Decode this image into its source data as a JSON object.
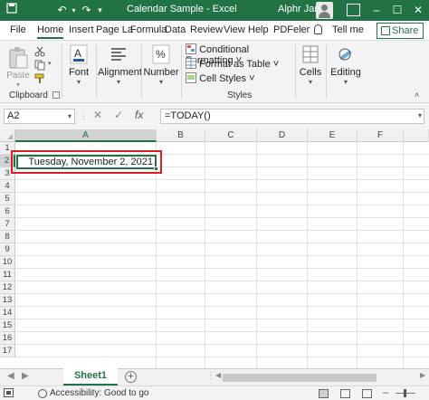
{
  "titlebar": {
    "title": "Calendar Sample  -  Excel",
    "user": "Alphr Jan",
    "icons": [
      "save-icon",
      "undo-icon",
      "redo-icon",
      "customize-qat-icon",
      "minimize-icon",
      "restore-icon",
      "close-icon"
    ]
  },
  "tabs": {
    "file": "File",
    "home": "Home",
    "insert": "Insert",
    "page_layout": "Page La",
    "formulas": "Formula",
    "data": "Data",
    "review": "Review",
    "view": "View",
    "help": "Help",
    "pdfeler": "PDFeler",
    "tell_me": "Tell me",
    "share": "Share"
  },
  "ribbon": {
    "clipboard": {
      "paste": "Paste",
      "group": "Clipboard"
    },
    "font": {
      "label": "Font"
    },
    "alignment": {
      "label": "Alignment"
    },
    "number": {
      "label": "Number"
    },
    "styles": {
      "conditional": "Conditional Formatting ˅",
      "format_table": "Format as Table ˅",
      "cell_styles": "Cell Styles ˅",
      "group": "Styles"
    },
    "cells": {
      "label": "Cells"
    },
    "editing": {
      "label": "Editing"
    }
  },
  "formula_bar": {
    "name_box": "A2",
    "formula": "=TODAY()",
    "fx": "fx"
  },
  "grid": {
    "columns": [
      "A",
      "B",
      "C",
      "D",
      "E",
      "F"
    ],
    "rows": [
      "1",
      "2",
      "3",
      "4",
      "5",
      "6",
      "7",
      "8",
      "9",
      "10",
      "11",
      "12",
      "13",
      "14",
      "15",
      "16",
      "17"
    ],
    "selected_cell": "A2",
    "A2_value": "Tuesday, November 2, 2021"
  },
  "sheets": {
    "active": "Sheet1",
    "add": "+"
  },
  "statusbar": {
    "accessibility": "Accessibility: Good to go"
  },
  "colors": {
    "accent": "#217346",
    "highlight": "#d6202a"
  }
}
